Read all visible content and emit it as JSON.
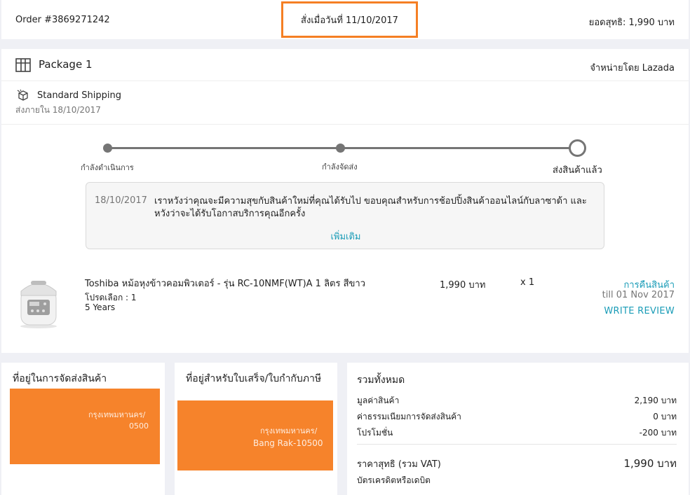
{
  "header": {
    "order_number": "Order #3869271242",
    "placed_on": "สั่งเมื่อวันที่ 11/10/2017",
    "net_total": "ยอดสุทธิ: 1,990 บาท"
  },
  "package": {
    "title": "Package 1",
    "seller": "จำหน่ายโดย Lazada",
    "shipping_method": "Standard Shipping",
    "delivery_by": "ส่งภายใน 18/10/2017",
    "steps": [
      "กำลังดำเนินการ",
      "กำลังจัดส่ง",
      "ส่งสินค้าแล้ว"
    ],
    "progress_step": 3,
    "message": {
      "date": "18/10/2017",
      "text": "เราหวังว่าคุณจะมีความสุขกับสินค้าใหม่ที่คุณได้รับไป ขอบคุณสำหรับการช้อปปิ้งสินค้าออนไลน์กับลาซาด้า และหวังว่าจะได้รับโอกาสบริการคุณอีกครั้ง",
      "more": "เพิ่มเติม"
    },
    "item": {
      "name": "Toshiba หม้อหุงข้าวคอมพิวเตอร์ - รุ่น RC-10NMF(WT)A 1 ลิตร สีขาว",
      "promo": "โปรดเลือก : 1",
      "warranty": "5 Years",
      "price": "1,990 บาท",
      "quantity": "x 1",
      "return_link": "การคืนสินค้า",
      "return_until": "till 01 Nov 2017",
      "review_link": "WRITE REVIEW"
    }
  },
  "shipping_address": {
    "title": "ที่อยู่ในการจัดส่งสินค้า",
    "visible_fragments": [
      "กรุงเทพมหานคร/",
      "0500"
    ]
  },
  "billing_address": {
    "title": "ที่อยู่สำหรับใบเสร็จ/ใบกำกับภาษี",
    "visible_fragments": [
      "กรุงเทพมหานคร/",
      "Bang Rak-10500"
    ]
  },
  "summary": {
    "title": "รวมทั้งหมด",
    "rows": [
      {
        "label": "มูลค่าสินค้า",
        "value": "2,190 บาท"
      },
      {
        "label": "ค่าธรรมเนียมการจัดส่งสินค้า",
        "value": "0 บาท"
      },
      {
        "label": "โปรโมชั่น",
        "value": "-200 บาท"
      }
    ],
    "grand_label": "ราคาสุทธิ (รวม VAT)",
    "grand_value": "1,990 บาท",
    "payment_method": "บัตรเครดิตหรือเดบิต"
  },
  "colors": {
    "accent": "#1a9cb7",
    "highlight": "#f57f24",
    "redaction": "#f6832b",
    "background": "#eff0f5"
  }
}
